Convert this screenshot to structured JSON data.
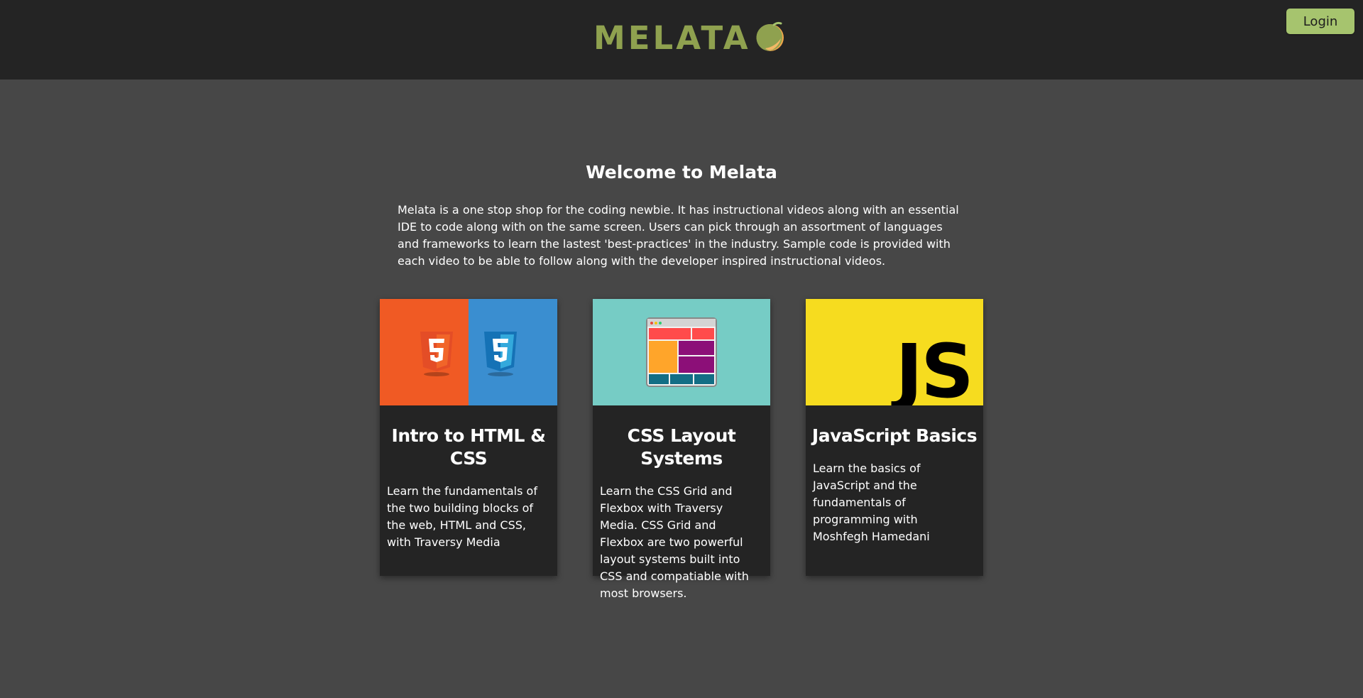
{
  "header": {
    "logo_text": "MELATA",
    "logo_icon": "melon-icon",
    "login_label": "Login"
  },
  "main": {
    "title": "Welcome to Melata",
    "intro": "Melata is a one stop shop for the coding newbie. It has instructional videos along with an essential IDE to code along with on the same screen. Users can pick through an assortment of languages and frameworks to learn the lastest 'best-practices' in the industry. Sample code is provided with each video to be able to follow along with the developer inspired instructional videos."
  },
  "cards": [
    {
      "title": "Intro to HTML & CSS",
      "description": "Learn the fundamentals of the two building blocks of the web, HTML and CSS, with Traversy Media",
      "image": "html5-css3-logos"
    },
    {
      "title": "CSS Layout Systems",
      "description": "Learn the CSS Grid and Flexbox with Traversy Media. CSS Grid and Flexbox are two powerful layout systems built into CSS and compatiable with most browsers.",
      "image": "layout-window-icon"
    },
    {
      "title": "JavaScript Basics",
      "description": "Learn the basics of JavaScript and the fundamentals of programming with Moshfegh Hamedani",
      "image": "js-logo",
      "image_text": "JS"
    }
  ],
  "colors": {
    "header_bg": "#242424",
    "page_bg": "#474747",
    "accent": "#a6c46e",
    "logo_green": "#8fa14f",
    "html_orange": "#f05a24",
    "css_blue": "#3a8ed0",
    "layout_teal": "#76ccc5",
    "js_yellow": "#f6dc1f"
  }
}
